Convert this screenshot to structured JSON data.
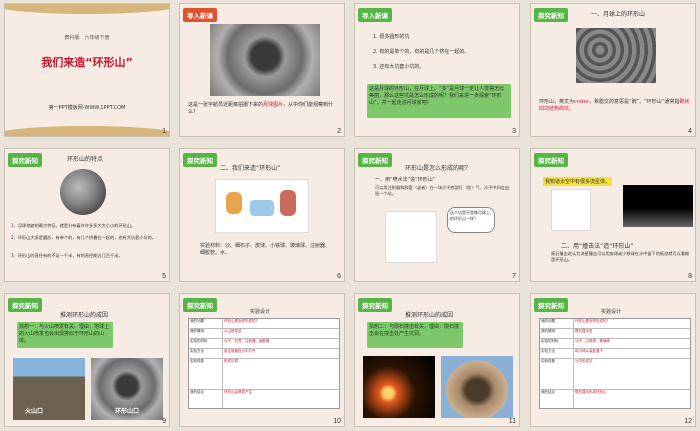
{
  "slides": [
    {
      "number": "1",
      "grade": "教科版　六年级下册",
      "title": "我们来造“环形山”",
      "footer": "第一PPT模板网-WWW.1PPT.COM"
    },
    {
      "number": "2",
      "tag": "导入新课",
      "caption": "这是一张宇航员近距离拍摄下来的",
      "caption_highlight": "月球图片",
      "caption_end": "，从中你们能观察到什么？"
    },
    {
      "number": "3",
      "tag": "导入新课",
      "list": [
        "1. 很多圆形的坑",
        "2. 有的是单个的，有的是几个挤在一起的。",
        "3. 还有大坑套小坑的。"
      ],
      "box": "这是月球的环形山，在月球上。“多”是月球一定让人觉得无比美丽，那么这些坑是怎么形成的呢？我们来进一步探索“环形山”，并一起走进月球家吧！"
    },
    {
      "number": "4",
      "tag": "探究新知",
      "heading": "一、月球上的环形山",
      "body": "环形山，英文为",
      "body_hl": "crater",
      "body2": "，希腊文的意思是“碗”。“环形山”通常指",
      "body_hl2": "碗状凹坑结构的坑。"
    },
    {
      "number": "5",
      "tag": "探究新知",
      "heading": "环形山的特点",
      "points": [
        "1、月球地貌的最大特征，就是分布着许许多多大大小小的环形山。",
        "2、环形山大多是圆形，有单个的，有几个挤叠在一起的，也有大坑套小坑的。",
        "3、环形山的直径有的不足一千米，有的直径能达几百千米。"
      ]
    },
    {
      "number": "6",
      "tag": "探究新知",
      "heading": "二、我们来造“环形山”",
      "materials": "实验材料：沙、细石子、皮球、小铁球、玻璃球、注射器、细胶管、水。"
    },
    {
      "number": "7",
      "tag": "探究新知",
      "heading": "环形山是怎么形成的呢？",
      "steps": [
        "一、用“喷水法”造“环形山”",
        "可以用注射器和胶管（或者）在一块沙子底部打（吹）气，沙子中间会出现一个坑。"
      ],
      "bubble": "这个坑是不是像月球上的环形山一样？"
    },
    {
      "number": "8",
      "tag": "探究新知",
      "banner": "我知道太空中有很多流星体。",
      "heading": "二、用“撞击法”造“环形山”",
      "body": "陨石撞击说认为流星撞击可以用皮球或小铁球在沙中留下的痕迹就可以看做是环形山。"
    },
    {
      "number": "9",
      "tag": "探究新知",
      "heading": "推测环形山的成因",
      "box": "猜想一：与火山喷发有关。理由：地球上的火山喷发也会出现类似于环形山的山体。",
      "label1": "火山口",
      "label2": "环形山口"
    },
    {
      "number": "10",
      "tag": "探究新知",
      "heading": "实验设计",
      "rows": [
        [
          "我的问题",
          "环形山是怎样形成的？"
        ],
        [
          "我的猜测",
          "火山喷发说"
        ],
        [
          "实验的材料",
          "沙子、石膏、注射器、细胶管"
        ],
        [
          "实验方法",
          "用注射器在沙中打气"
        ],
        [
          "实验现象",
          "形成坑洞"
        ],
        [
          "我的结论",
          "环形山由喷发产生"
        ]
      ]
    },
    {
      "number": "11",
      "tag": "探究新知",
      "heading": "推测环形山的成因",
      "box": "猜想二：与陨石撞击有关。理由：陨石撞击会在撞击处产生坑洞。"
    },
    {
      "number": "12",
      "tag": "探究新知",
      "heading": "实验设计",
      "rows": [
        [
          "我的问题",
          "环形山是怎样形成的？"
        ],
        [
          "我的猜测",
          "陨石撞击说"
        ],
        [
          "实验的材料",
          "沙子、小铁球、玻璃球"
        ],
        [
          "实验方法",
          "将小球从高处落下"
        ],
        [
          "实验现象",
          "沙中形成坑"
        ],
        [
          "我的结论",
          "陨石撞击形成环形山"
        ]
      ]
    }
  ]
}
